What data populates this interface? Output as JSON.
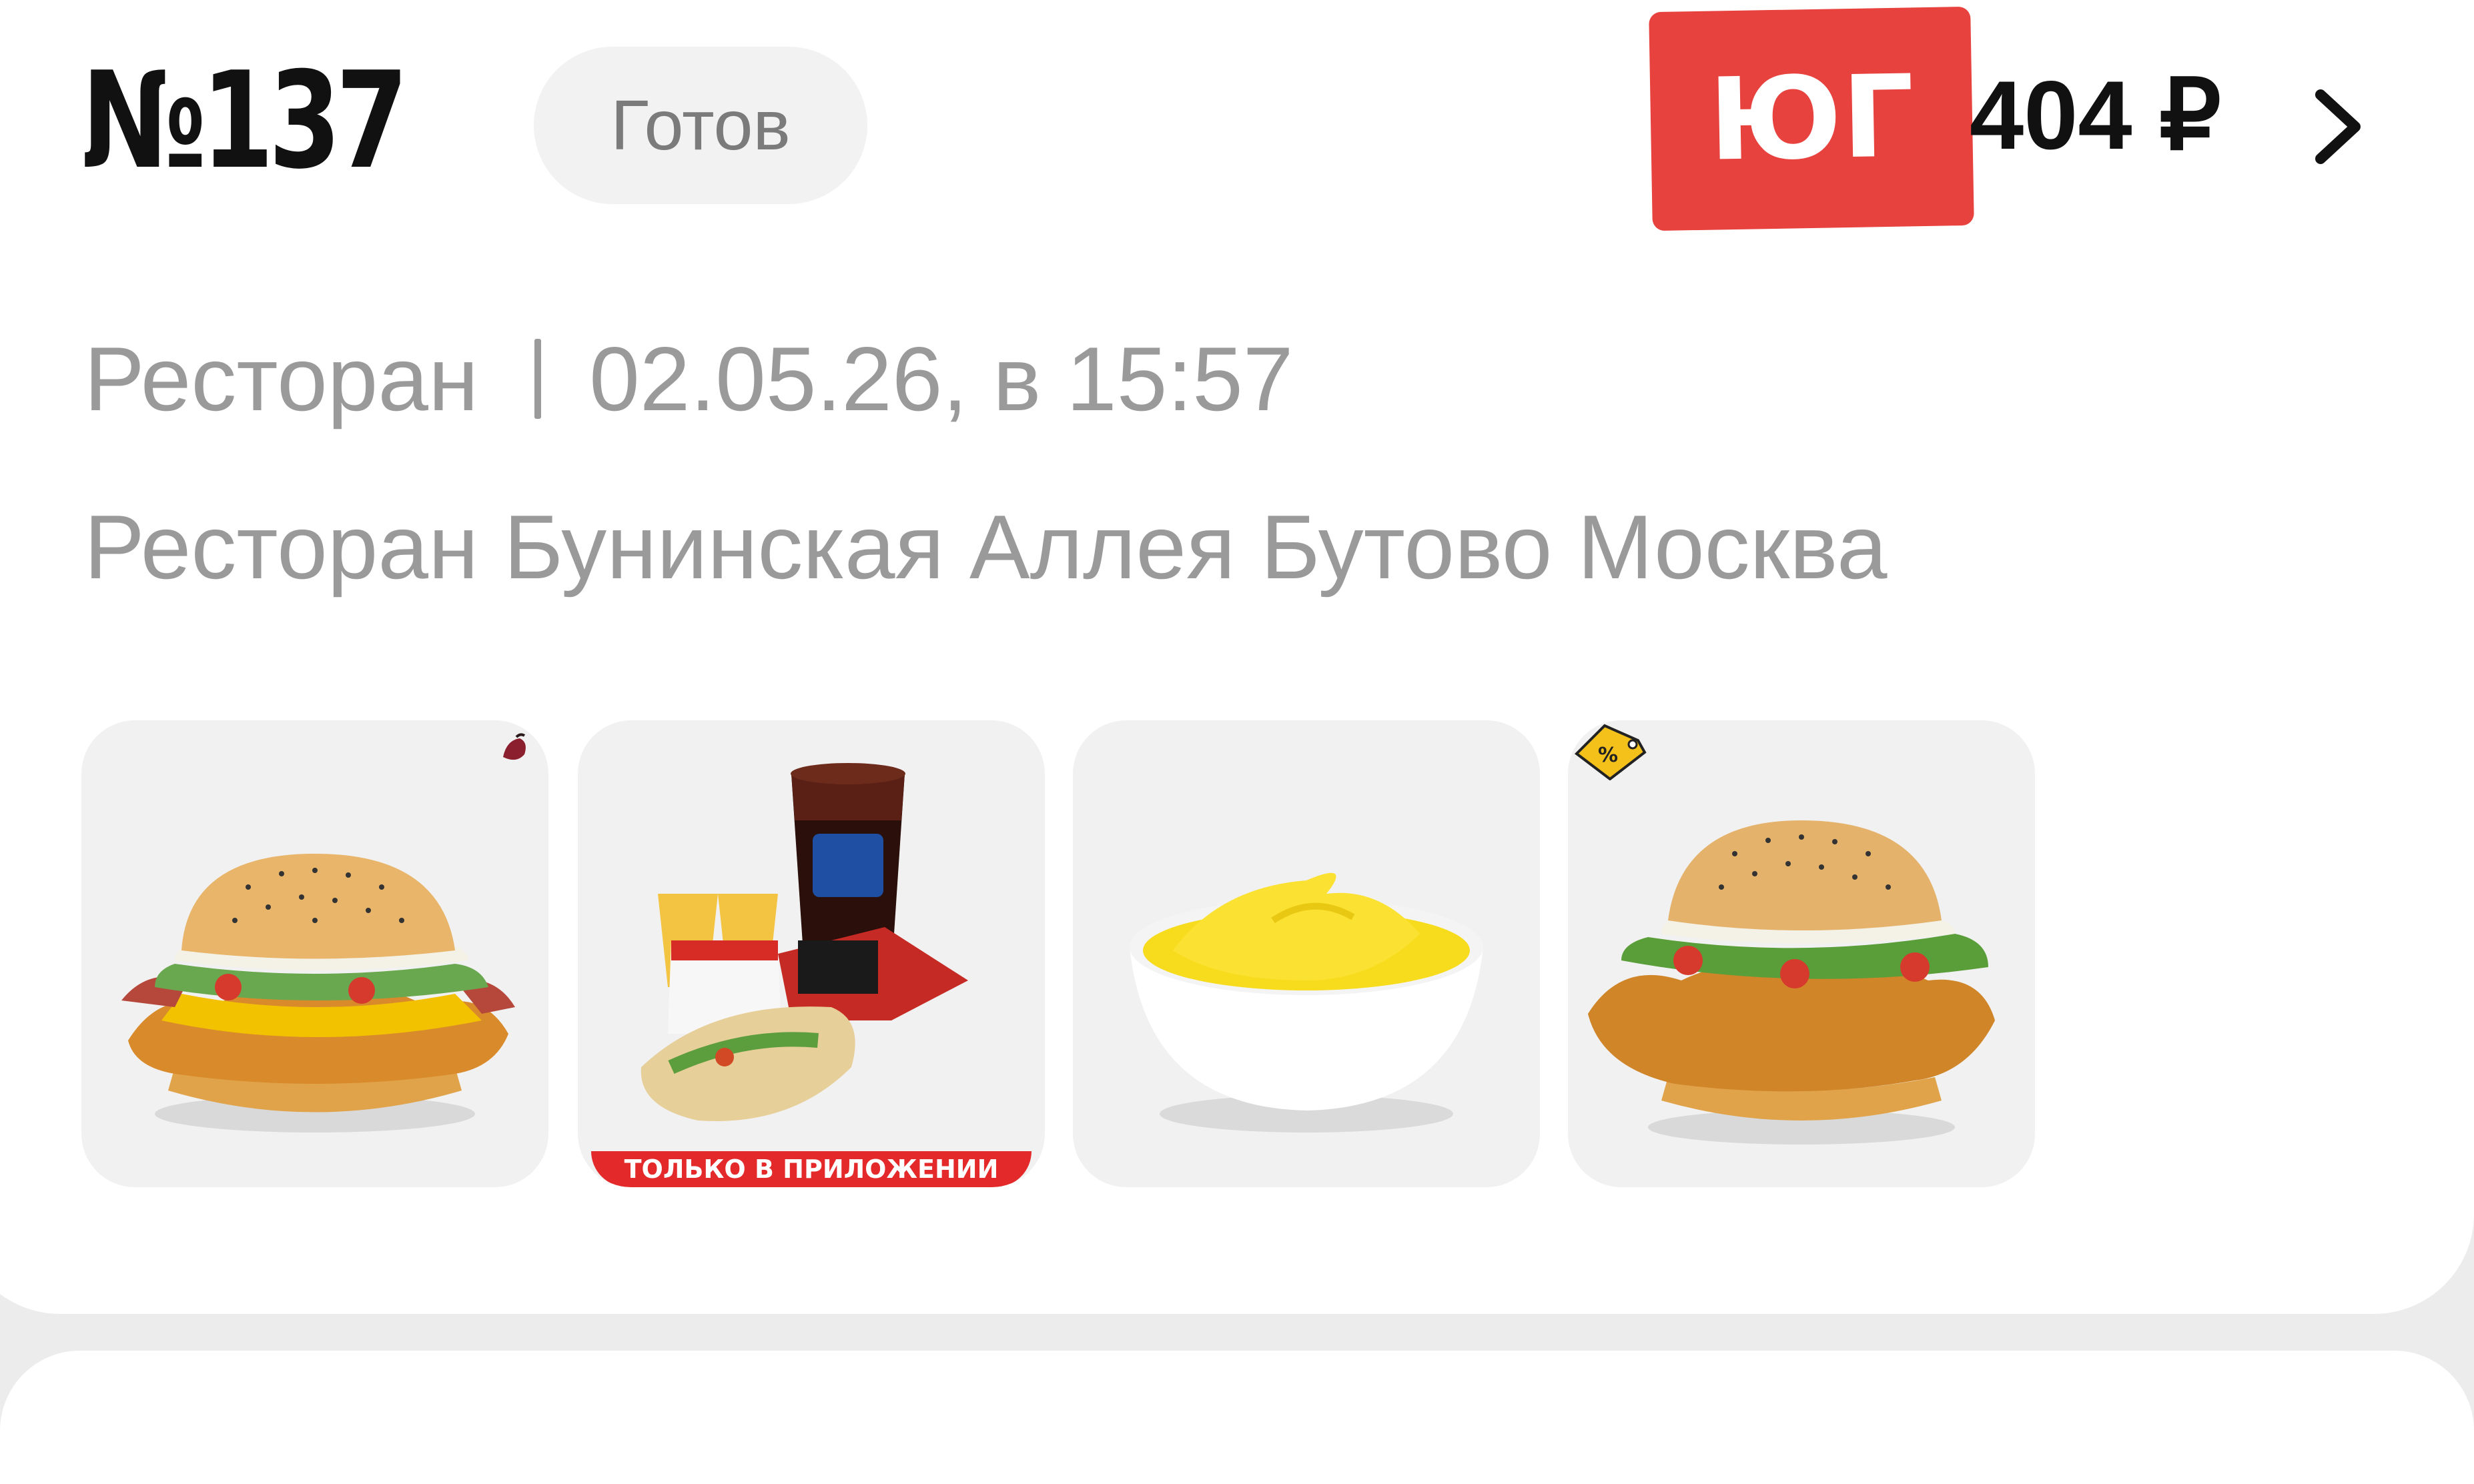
{
  "order": {
    "number": "№137",
    "status": "Готов",
    "price": "404 ₽"
  },
  "badge": {
    "text": "ЮГ",
    "color": "#e8423f"
  },
  "meta": {
    "type": "Ресторан",
    "datetime": "02.05.26, в 15:57",
    "address": "Ресторан Бунинская Аллея Бутово Москва"
  },
  "items": [
    {
      "icon": "chicken-burger-bacon-icon"
    },
    {
      "icon": "combo-twister-fries-drink-icon",
      "promo_label": "ТОЛЬКО В ПРИЛОЖЕНИИ"
    },
    {
      "icon": "cheese-sauce-icon"
    },
    {
      "icon": "chicken-burger-icon"
    }
  ]
}
